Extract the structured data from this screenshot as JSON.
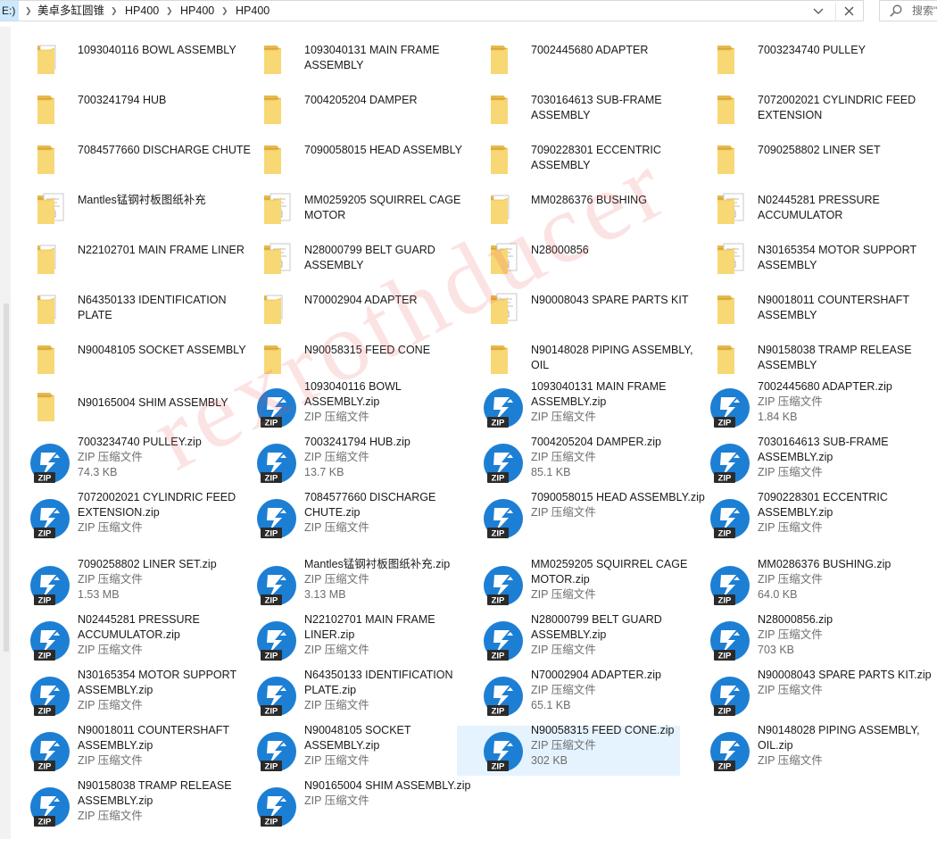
{
  "address": {
    "drive": "E:)",
    "crumbs": [
      "美卓多缸圆锥",
      "HP400",
      "HP400",
      "HP400"
    ]
  },
  "search": {
    "placeholder": "搜索\""
  },
  "watermark": "rexrothducer",
  "items": [
    {
      "name": "1093040116 BOWL ASSEMBLY",
      "kind": "folder",
      "overlay": "edge"
    },
    {
      "name": "1093040131 MAIN FRAME ASSEMBLY",
      "kind": "folder"
    },
    {
      "name": "7002445680 ADAPTER",
      "kind": "folder"
    },
    {
      "name": "7003234740 PULLEY",
      "kind": "folder"
    },
    {
      "name": "7003241794 HUB",
      "kind": "folder"
    },
    {
      "name": "7004205204 DAMPER",
      "kind": "folder"
    },
    {
      "name": "7030164613 SUB-FRAME ASSEMBLY",
      "kind": "folder"
    },
    {
      "name": "7072002021 CYLINDRIC FEED EXTENSION",
      "kind": "folder"
    },
    {
      "name": "7084577660 DISCHARGE CHUTE",
      "kind": "folder"
    },
    {
      "name": "7090058015 HEAD ASSEMBLY",
      "kind": "folder"
    },
    {
      "name": "7090228301 ECCENTRIC ASSEMBLY",
      "kind": "folder"
    },
    {
      "name": "7090258802 LINER SET",
      "kind": "folder"
    },
    {
      "name": "Mantles锰钢衬板图纸补充",
      "kind": "folder",
      "overlay": "doc"
    },
    {
      "name": "MM0259205 SQUIRREL CAGE MOTOR",
      "kind": "folder",
      "overlay": "doc"
    },
    {
      "name": "MM0286376 BUSHING",
      "kind": "folder",
      "overlay": "edge"
    },
    {
      "name": "N02445281 PRESSURE ACCUMULATOR",
      "kind": "folder",
      "overlay": "doc"
    },
    {
      "name": "N22102701 MAIN FRAME LINER",
      "kind": "folder",
      "overlay": "edge"
    },
    {
      "name": "N28000799 BELT GUARD ASSEMBLY",
      "kind": "folder",
      "overlay": "doc"
    },
    {
      "name": "N28000856",
      "kind": "folder",
      "overlay": "doc"
    },
    {
      "name": "N30165354 MOTOR SUPPORT ASSEMBLY",
      "kind": "folder",
      "overlay": "doc"
    },
    {
      "name": "N64350133 IDENTIFICATION PLATE",
      "kind": "folder",
      "overlay": "edge"
    },
    {
      "name": "N70002904 ADAPTER",
      "kind": "folder",
      "overlay": "edge"
    },
    {
      "name": "N90008043 SPARE PARTS KIT",
      "kind": "folder",
      "overlay": "doc"
    },
    {
      "name": "N90018011 COUNTERSHAFT ASSEMBLY",
      "kind": "folder"
    },
    {
      "name": "N90048105 SOCKET ASSEMBLY",
      "kind": "folder"
    },
    {
      "name": "N90058315 FEED CONE",
      "kind": "folder"
    },
    {
      "name": "N90148028 PIPING ASSEMBLY, OIL",
      "kind": "folder"
    },
    {
      "name": "N90158038 TRAMP RELEASE ASSEMBLY",
      "kind": "folder"
    },
    {
      "name": "N90165004 SHIM ASSEMBLY",
      "kind": "folder"
    },
    {
      "name": "1093040116 BOWL ASSEMBLY.zip",
      "kind": "zip",
      "type": "ZIP 压缩文件",
      "size": ""
    },
    {
      "name": "1093040131 MAIN FRAME ASSEMBLY.zip",
      "kind": "zip",
      "type": "ZIP 压缩文件",
      "size": ""
    },
    {
      "name": "7002445680 ADAPTER.zip",
      "kind": "zip",
      "type": "ZIP 压缩文件",
      "size": "1.84 KB"
    },
    {
      "name": "7003234740 PULLEY.zip",
      "kind": "zip",
      "type": "ZIP 压缩文件",
      "size": "74.3 KB"
    },
    {
      "name": "7003241794 HUB.zip",
      "kind": "zip",
      "type": "ZIP 压缩文件",
      "size": "13.7 KB"
    },
    {
      "name": "7004205204 DAMPER.zip",
      "kind": "zip",
      "type": "ZIP 压缩文件",
      "size": "85.1 KB"
    },
    {
      "name": "7030164613 SUB-FRAME ASSEMBLY.zip",
      "kind": "zip",
      "type": "ZIP 压缩文件",
      "size": ""
    },
    {
      "name": "7072002021 CYLINDRIC FEED EXTENSION.zip",
      "kind": "zip",
      "type": "ZIP 压缩文件",
      "size": ""
    },
    {
      "name": "7084577660 DISCHARGE CHUTE.zip",
      "kind": "zip",
      "type": "ZIP 压缩文件",
      "size": ""
    },
    {
      "name": "7090058015 HEAD ASSEMBLY.zip",
      "kind": "zip",
      "type": "ZIP 压缩文件",
      "size": ""
    },
    {
      "name": "7090228301 ECCENTRIC ASSEMBLY.zip",
      "kind": "zip",
      "type": "ZIP 压缩文件",
      "size": ""
    },
    {
      "name": "7090258802 LINER SET.zip",
      "kind": "zip",
      "type": "ZIP 压缩文件",
      "size": "1.53 MB"
    },
    {
      "name": "Mantles锰钢衬板图纸补充.zip",
      "kind": "zip",
      "type": "ZIP 压缩文件",
      "size": "3.13 MB"
    },
    {
      "name": "MM0259205 SQUIRREL CAGE MOTOR.zip",
      "kind": "zip",
      "type": "ZIP 压缩文件",
      "size": ""
    },
    {
      "name": "MM0286376 BUSHING.zip",
      "kind": "zip",
      "type": "ZIP 压缩文件",
      "size": "64.0 KB"
    },
    {
      "name": "N02445281 PRESSURE ACCUMULATOR.zip",
      "kind": "zip",
      "type": "ZIP 压缩文件",
      "size": ""
    },
    {
      "name": "N22102701 MAIN FRAME LINER.zip",
      "kind": "zip",
      "type": "ZIP 压缩文件",
      "size": ""
    },
    {
      "name": "N28000799 BELT GUARD ASSEMBLY.zip",
      "kind": "zip",
      "type": "ZIP 压缩文件",
      "size": ""
    },
    {
      "name": "N28000856.zip",
      "kind": "zip",
      "type": "ZIP 压缩文件",
      "size": "703 KB"
    },
    {
      "name": "N30165354 MOTOR SUPPORT ASSEMBLY.zip",
      "kind": "zip",
      "type": "ZIP 压缩文件",
      "size": ""
    },
    {
      "name": "N64350133 IDENTIFICATION PLATE.zip",
      "kind": "zip",
      "type": "ZIP 压缩文件",
      "size": ""
    },
    {
      "name": "N70002904 ADAPTER.zip",
      "kind": "zip",
      "type": "ZIP 压缩文件",
      "size": "65.1 KB"
    },
    {
      "name": "N90008043 SPARE PARTS KIT.zip",
      "kind": "zip",
      "type": "ZIP 压缩文件",
      "size": ""
    },
    {
      "name": "N90018011 COUNTERSHAFT ASSEMBLY.zip",
      "kind": "zip",
      "type": "ZIP 压缩文件",
      "size": ""
    },
    {
      "name": "N90048105 SOCKET ASSEMBLY.zip",
      "kind": "zip",
      "type": "ZIP 压缩文件",
      "size": ""
    },
    {
      "name": "N90058315 FEED CONE.zip",
      "kind": "zip",
      "type": "ZIP 压缩文件",
      "size": "302 KB",
      "selected": true
    },
    {
      "name": "N90148028 PIPING ASSEMBLY, OIL.zip",
      "kind": "zip",
      "type": "ZIP 压缩文件",
      "size": ""
    },
    {
      "name": "N90158038 TRAMP RELEASE ASSEMBLY.zip",
      "kind": "zip",
      "type": "ZIP 压缩文件",
      "size": ""
    },
    {
      "name": "N90165004 SHIM ASSEMBLY.zip",
      "kind": "zip",
      "type": "ZIP 压缩文件",
      "size": ""
    }
  ]
}
